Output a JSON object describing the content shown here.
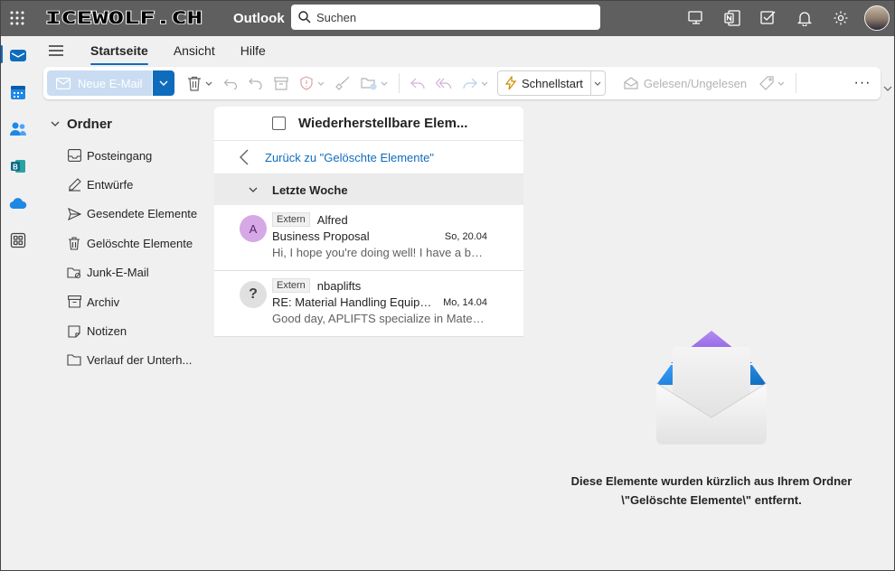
{
  "topbar": {
    "brand": "ICEWOLF.CH",
    "app_name": "Outlook",
    "search_placeholder": "Suchen"
  },
  "tabs": [
    {
      "label": "Startseite",
      "active": true
    },
    {
      "label": "Ansicht",
      "active": false
    },
    {
      "label": "Hilfe",
      "active": false
    }
  ],
  "ribbon": {
    "new_mail": "Neue E-Mail",
    "quick_steps": "Schnellstart",
    "read_unread": "Gelesen/Ungelesen",
    "more": "···"
  },
  "folders": {
    "header": "Ordner",
    "items": [
      {
        "label": "Posteingang",
        "icon": "inbox-icon"
      },
      {
        "label": "Entwürfe",
        "icon": "pencil-icon"
      },
      {
        "label": "Gesendete Elemente",
        "icon": "send-icon"
      },
      {
        "label": "Gelöschte Elemente",
        "icon": "trash-icon"
      },
      {
        "label": "Junk-E-Mail",
        "icon": "junk-folder-icon"
      },
      {
        "label": "Archiv",
        "icon": "archive-icon"
      },
      {
        "label": "Notizen",
        "icon": "note-icon"
      },
      {
        "label": "Verlauf der Unterh...",
        "icon": "folder-icon"
      }
    ]
  },
  "message_list": {
    "title": "Wiederherstellbare Elem...",
    "back_link": "Zurück zu \"Gelöschte Elemente\"",
    "group_label": "Letzte Woche",
    "messages": [
      {
        "avatar": "A",
        "avatar_color": "#d6a8e6",
        "tag": "Extern",
        "sender": "Alfred",
        "subject": "Business Proposal",
        "date": "So, 20.04",
        "preview": "Hi, I hope you're doing well! I have a bus..."
      },
      {
        "avatar": "?",
        "avatar_color": "#e0e0e0",
        "tag": "Extern",
        "sender": "nbaplifts",
        "subject": "RE: Material Handling Equipm...",
        "date": "Mo, 14.04",
        "preview": "Good day, APLIFTS specialize in Material ..."
      }
    ]
  },
  "reading_pane": {
    "empty_message": "Diese Elemente wurden kürzlich aus Ihrem Ordner \\\"Gelöschte Elemente\\\" entfernt."
  },
  "colors": {
    "accent": "#0f6cbd",
    "topbar": "#5f5f5f"
  }
}
